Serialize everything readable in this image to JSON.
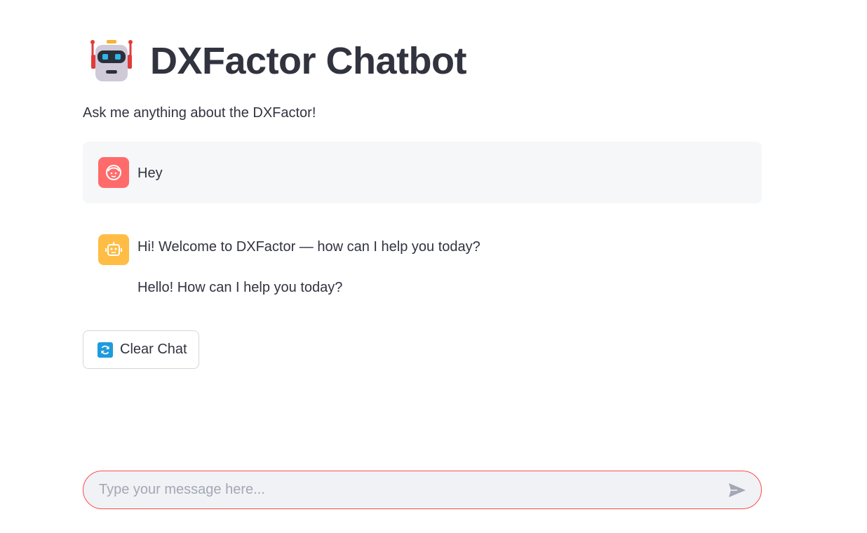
{
  "header": {
    "title": "DXFactor Chatbot",
    "logo_icon": "robot-icon"
  },
  "subtitle": "Ask me anything about the DXFactor!",
  "messages": [
    {
      "role": "user",
      "avatar_icon": "user-face-icon",
      "avatar_color": "#ff6b6b",
      "paragraphs": [
        "Hey"
      ]
    },
    {
      "role": "assistant",
      "avatar_icon": "robot-face-icon",
      "avatar_color": "#ffbd45",
      "paragraphs": [
        "Hi! Welcome to DXFactor — how can I help you today?",
        "Hello! How can I help you today?"
      ]
    }
  ],
  "clear_button": {
    "label": "Clear Chat",
    "icon": "refresh-icon"
  },
  "chat_input": {
    "placeholder": "Type your message here...",
    "value": "",
    "border_color": "#ff4b4b",
    "send_icon": "send-icon"
  }
}
